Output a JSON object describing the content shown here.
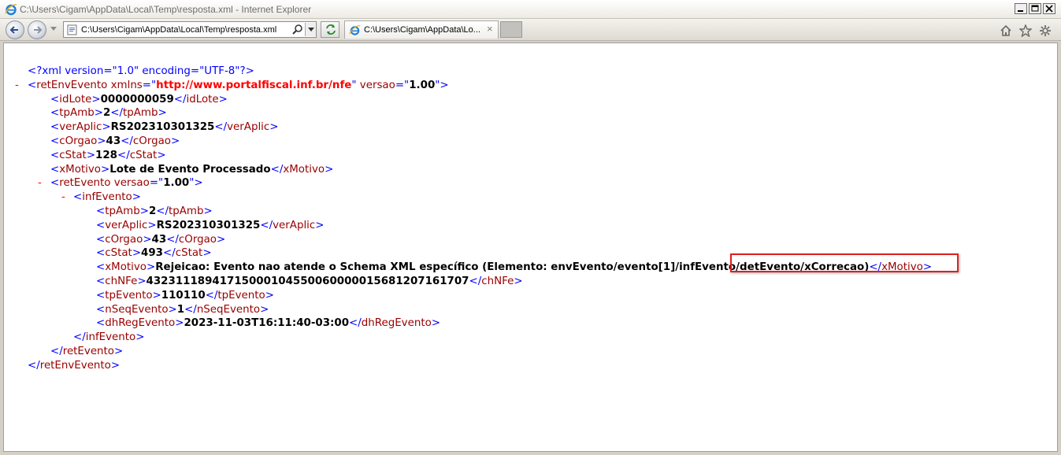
{
  "window": {
    "title": "C:\\Users\\Cigam\\AppData\\Local\\Temp\\resposta.xml - Internet Explorer",
    "buttons": [
      "minimize",
      "maximize",
      "close"
    ]
  },
  "toolbar": {
    "address": "C:\\Users\\Cigam\\AppData\\Local\\Temp\\resposta.xml",
    "tab_label": "C:\\Users\\Cigam\\AppData\\Lo...",
    "tab_close": "×",
    "icons": [
      "back-icon",
      "forward-icon",
      "search-icon",
      "compatibility-icon",
      "home-icon",
      "favorites-icon",
      "tools-icon"
    ]
  },
  "xml": {
    "declaration": "<?xml version=\"1.0\" encoding=\"UTF-8\"?>",
    "root_tag": "retEnvEvento",
    "root_xmlns_attr": "xmlns",
    "root_xmlns_value": "http://www.portalfiscal.inf.br/nfe",
    "root_versao_attr": "versao",
    "root_versao_value": "1.00",
    "top_fields": [
      {
        "tag": "idLote",
        "value": "0000000059"
      },
      {
        "tag": "tpAmb",
        "value": "2"
      },
      {
        "tag": "verAplic",
        "value": "RS202310301325"
      },
      {
        "tag": "cOrgao",
        "value": "43"
      },
      {
        "tag": "cStat",
        "value": "128"
      },
      {
        "tag": "xMotivo",
        "value": "Lote de Evento Processado"
      }
    ],
    "ret_evento_tag": "retEvento",
    "ret_evento_versao": "1.00",
    "inf_evento_tag": "infEvento",
    "inf_fields": [
      {
        "tag": "tpAmb",
        "value": "2"
      },
      {
        "tag": "verAplic",
        "value": "RS202310301325"
      },
      {
        "tag": "cOrgao",
        "value": "43"
      },
      {
        "tag": "cStat",
        "value": "493"
      },
      {
        "tag": "xMotivo",
        "value": "Rejeicao: Evento nao atende o Schema XML específico (Elemento: envEvento/evento[1]/infEvento/detEvento/xCorrecao)"
      },
      {
        "tag": "chNFe",
        "value": "43231118941715000104550060000015681207161707"
      },
      {
        "tag": "tpEvento",
        "value": "110110"
      },
      {
        "tag": "nSeqEvento",
        "value": "1"
      },
      {
        "tag": "dhRegEvento",
        "value": "2023-11-03T16:11:40-03:00"
      }
    ],
    "collapse_marker": "-"
  },
  "highlight": {
    "text": "/infEvento/detEvento/xCorrecao)",
    "color": "#e02020"
  }
}
